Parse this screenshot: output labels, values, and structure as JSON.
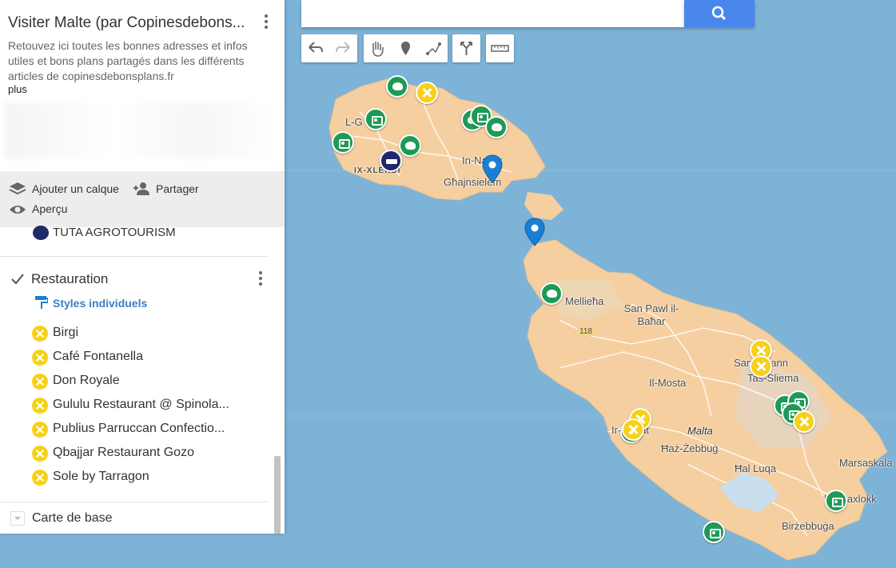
{
  "panel": {
    "title": "Visiter Malte (par Copinesdebons...",
    "description": "Retouvez ici toutes les bonnes adresses et infos utiles et bons plans partagés dans les différents articles de copinesdebonsplans.fr",
    "more": "plus",
    "actions": {
      "add_layer": "Ajouter un calque",
      "share": "Partager",
      "preview": "Aperçu"
    },
    "prev_item": "TUTA AGROTOURISM",
    "layer": {
      "title": "Restauration",
      "styles": "Styles individuels",
      "items": [
        "Birgi",
        "Café Fontanella",
        "Don Royale",
        "Gululu Restaurant @ Spinola...",
        "Publius Parruccan Confectio...",
        "Qbajjar Restaurant Gozo",
        "Sole by Tarragon"
      ]
    },
    "basemap": "Carte de base"
  },
  "map": {
    "labels": [
      "L-G",
      "In-Nadur",
      "Għajnsielem",
      "IX-XLENDI",
      "Mellieħa",
      "San Pawl il-Baħar",
      "118",
      "San Ġwann",
      "Tas-Sliema",
      "Il-Mosta",
      "Malta",
      "Ħaż-Żebbuġ",
      "Ħal Luqa",
      "Marsaskala",
      "Marsaxlokk",
      "Birżebbuġa",
      "Ir-Rabat"
    ],
    "colors": {
      "sea": "#7eb3d8",
      "land": "#f5cfa0",
      "green_marker": "#1e9a57",
      "yellow_marker": "#f7d117",
      "pin": "#1a7fd4",
      "navy_marker": "#1f2a6b",
      "search": "#4a87ec"
    }
  }
}
